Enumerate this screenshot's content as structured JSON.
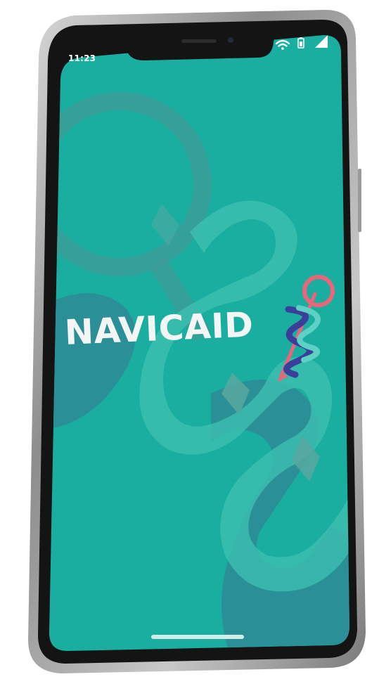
{
  "status_bar": {
    "time": "11:23",
    "icons": [
      "wifi-icon",
      "battery-icon",
      "cellular-signal-icon"
    ]
  },
  "splash": {
    "brand_name": "NAVICAID",
    "logo_icon": "caduceus-icon"
  },
  "colors": {
    "screen_background": "#1aaea0",
    "pattern_dark": "#2a8f96",
    "pattern_light": "#3dbfb0",
    "wordmark": "#f4f6f6",
    "logo_ring": "#e8657a",
    "logo_snake_teal": "#5fd0c4",
    "logo_snake_navy": "#3a3f9a",
    "phone_frame": "#1c1c1c"
  },
  "home_indicator": "home-indicator-bar"
}
